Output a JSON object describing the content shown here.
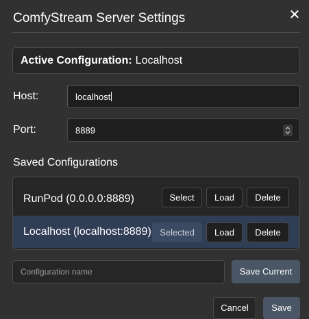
{
  "dialog": {
    "title": "ComfyStream Server Settings",
    "close_icon": "close-icon",
    "close_glyph": "✕"
  },
  "active": {
    "label": "Active Configuration:",
    "value": "Localhost"
  },
  "host": {
    "label": "Host:",
    "value": "localhost"
  },
  "port": {
    "label": "Port:",
    "value": "8889",
    "stepper_icon": "up-down-stepper-icon"
  },
  "saved": {
    "label": "Saved Configurations",
    "items": [
      {
        "name": "RunPod (0.0.0.0:8889)",
        "select_label": "Select",
        "load_label": "Load",
        "delete_label": "Delete",
        "selected": false
      },
      {
        "name": "Localhost (localhost:8889)",
        "select_label": "Selected",
        "load_label": "Load",
        "delete_label": "Delete",
        "selected": true
      }
    ]
  },
  "config_name": {
    "placeholder": "Configuration name",
    "value": ""
  },
  "buttons": {
    "save_current": "Save Current",
    "cancel": "Cancel",
    "save": "Save"
  },
  "colors": {
    "background": "#313131",
    "panel": "#262626",
    "selected_row": "#2f3d55",
    "primary_button": "#4a5566",
    "border": "#4a4a4a"
  }
}
